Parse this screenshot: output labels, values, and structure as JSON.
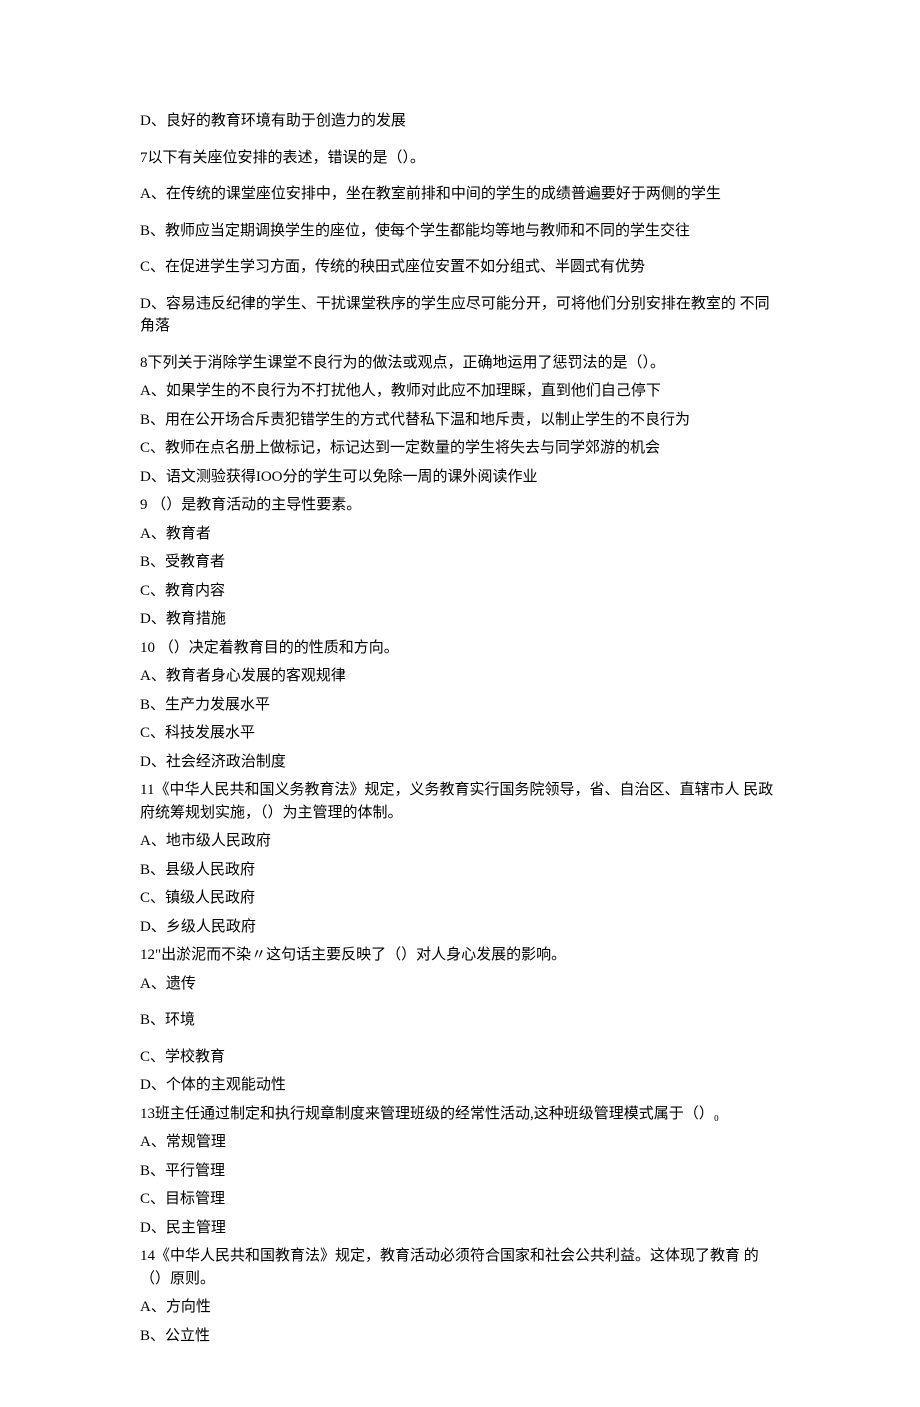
{
  "lines": [
    "D、良好的教育环境有助于创造力的发展",
    "7以下有关座位安排的表述，错误的是（）。",
    "A、在传统的课堂座位安排中，坐在教室前排和中间的学生的成绩普遍要好于两侧的学生",
    "B、教师应当定期调换学生的座位，使每个学生都能均等地与教师和不同的学生交往",
    "C、在促进学生学习方面，传统的秧田式座位安置不如分组式、半圆式有优势",
    "D、容易违反纪律的学生、干扰课堂秩序的学生应尽可能分开，可将他们分别安排在教室的 不同角落",
    "8下列关于消除学生课堂不良行为的做法或观点，正确地运用了惩罚法的是（）。",
    "A、如果学生的不良行为不打扰他人，教师对此应不加理睬，直到他们自己停下",
    "B、用在公开场合斥责犯错学生的方式代替私下温和地斥责，以制止学生的不良行为",
    "C、教师在点名册上做标记，标记达到一定数量的学生将失去与同学郊游的机会",
    "D、语文测验获得IOO分的学生可以免除一周的课外阅读作业",
    "9 （）是教育活动的主导性要素。",
    "A、教育者",
    "B、受教育者",
    "C、教育内容",
    "D、教育措施",
    "10 （）决定着教育目的的性质和方向。",
    "A、教育者身心发展的客观规律",
    "B、生产力发展水平",
    "C、科技发展水平",
    "D、社会经济政治制度",
    "11《中华人民共和国义务教育法》规定，义务教育实行国务院领导，省、自治区、直辖市人 民政府统筹规划实施，（）为主管理的体制。",
    "A、地市级人民政府",
    "B、县级人民政府",
    "C、镇级人民政府",
    "D、乡级人民政府",
    "12\"出淤泥而不染〃这句话主要反映了（）对人身心发展的影响。",
    "A、遗传",
    "B、环境",
    "C、学校教育",
    "D、个体的主观能动性",
    "13班主任通过制定和执行规章制度来管理班级的经常性活动,这种班级管理模式属于（）₀",
    "A、常规管理",
    "B、平行管理",
    "C、目标管理",
    "D、民主管理",
    "14《中华人民共和国教育法》规定，教育活动必须符合国家和社会公共利益。这体现了教育 的（）原则。",
    "A、方向性",
    "B、公立性"
  ]
}
